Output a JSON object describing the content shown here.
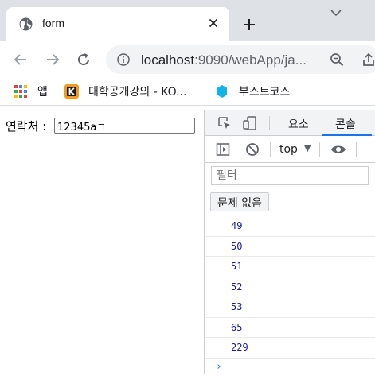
{
  "browser": {
    "tab_title": "form",
    "url_host": "localhost",
    "url_rest": ":9090/webApp/ja...",
    "bookmarks": [
      {
        "label": "앱",
        "icon": "apps-grid-icon"
      },
      {
        "label": "대학공개강의 - KO...",
        "icon": "kocw-icon"
      },
      {
        "label": "부스트코스",
        "icon": "boostcourse-icon"
      }
    ]
  },
  "page": {
    "field_label": "연락처 :",
    "field_value": "12345aㄱ"
  },
  "devtools": {
    "tabs": [
      "요소",
      "콘솔"
    ],
    "active_tab": "콘솔",
    "context": "top",
    "filter_placeholder": "필터",
    "issues_label": "문제 없음",
    "logs": [
      "49",
      "50",
      "51",
      "52",
      "53",
      "65",
      "229"
    ],
    "prompt": "›"
  },
  "colors": {
    "accent": "#1a73e8",
    "log_number": "#1a1aa6",
    "tabstrip_bg": "#dee1e6"
  }
}
